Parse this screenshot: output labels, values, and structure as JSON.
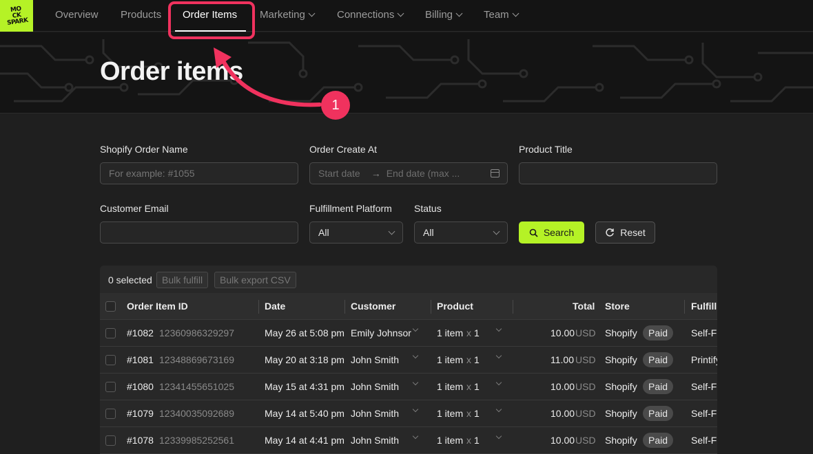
{
  "nav": {
    "logo_text": "MOCK SPARK",
    "items": [
      {
        "label": "Overview"
      },
      {
        "label": "Products"
      },
      {
        "label": "Order Items"
      },
      {
        "label": "Marketing"
      },
      {
        "label": "Connections"
      },
      {
        "label": "Billing"
      },
      {
        "label": "Team"
      }
    ]
  },
  "page": {
    "title": "Order items"
  },
  "annotation": {
    "step": "1",
    "color": "#f0325e"
  },
  "filters": {
    "order_name": {
      "label": "Shopify Order Name",
      "placeholder": "For example: #1055"
    },
    "create_at": {
      "label": "Order Create At",
      "start_placeholder": "Start date",
      "end_placeholder": "End date (max ...",
      "separator": "→"
    },
    "product_title": {
      "label": "Product Title",
      "value": ""
    },
    "customer_email": {
      "label": "Customer Email",
      "value": ""
    },
    "fulfillment_platform": {
      "label": "Fulfillment Platform",
      "value": "All"
    },
    "status": {
      "label": "Status",
      "value": "All"
    },
    "search_label": "Search",
    "reset_label": "Reset"
  },
  "table": {
    "selected_text": "0 selected",
    "bulk_fulfill": "Bulk fulfill",
    "bulk_export": "Bulk export CSV",
    "columns": {
      "order_item_id": "Order Item ID",
      "date": "Date",
      "customer": "Customer",
      "product": "Product",
      "total": "Total",
      "store": "Store",
      "fulfillment": "Fulfillm"
    },
    "rows": [
      {
        "order": "#1082",
        "id": "12360986329297",
        "date": "May 26 at 5:08 pm",
        "customer": "Emily Johnsor",
        "product": "1 item",
        "x": "x",
        "qty": "1",
        "total": "10.00",
        "currency": "USD",
        "store": "Shopify",
        "status": "Paid",
        "fulfillment": "Self-Fu"
      },
      {
        "order": "#1081",
        "id": "12348869673169",
        "date": "May 20 at 3:18 pm",
        "customer": "John Smith",
        "product": "1 item",
        "x": "x",
        "qty": "1",
        "total": "11.00",
        "currency": "USD",
        "store": "Shopify",
        "status": "Paid",
        "fulfillment": "Printify"
      },
      {
        "order": "#1080",
        "id": "12341455651025",
        "date": "May 15 at 4:31 pm",
        "customer": "John Smith",
        "product": "1 item",
        "x": "x",
        "qty": "1",
        "total": "10.00",
        "currency": "USD",
        "store": "Shopify",
        "status": "Paid",
        "fulfillment": "Self-Fu"
      },
      {
        "order": "#1079",
        "id": "12340035092689",
        "date": "May 14 at 5:40 pm",
        "customer": "John Smith",
        "product": "1 item",
        "x": "x",
        "qty": "1",
        "total": "10.00",
        "currency": "USD",
        "store": "Shopify",
        "status": "Paid",
        "fulfillment": "Self-Fu"
      },
      {
        "order": "#1078",
        "id": "12339985252561",
        "date": "May 14 at 4:41 pm",
        "customer": "John Smith",
        "product": "1 item",
        "x": "x",
        "qty": "1",
        "total": "10.00",
        "currency": "USD",
        "store": "Shopify",
        "status": "Paid",
        "fulfillment": "Self-Fu"
      }
    ]
  },
  "colors": {
    "accent": "#b5f226",
    "annotation": "#f0325e",
    "background": "#1f1f1f"
  }
}
